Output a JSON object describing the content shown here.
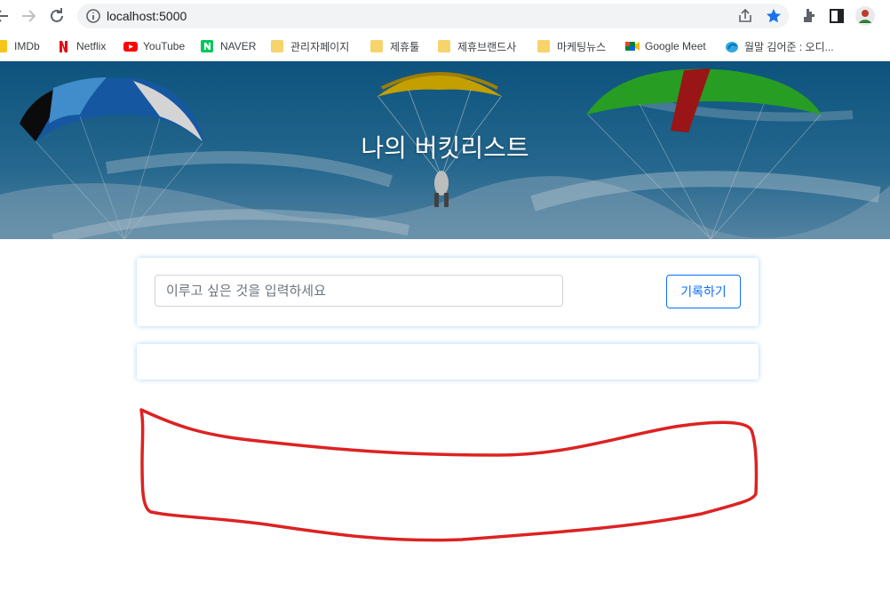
{
  "browser": {
    "url": "localhost:5000",
    "bookmarks": [
      {
        "label": "IMDb",
        "icon": "imdb-icon"
      },
      {
        "label": "Netflix",
        "icon": "netflix-icon"
      },
      {
        "label": "YouTube",
        "icon": "youtube-icon"
      },
      {
        "label": "NAVER",
        "icon": "naver-icon"
      },
      {
        "label": "관리자페이지",
        "icon": "folder-icon"
      },
      {
        "label": "제휴툴",
        "icon": "folder-icon"
      },
      {
        "label": "제휴브랜드사",
        "icon": "folder-icon"
      },
      {
        "label": "마케팅뉴스",
        "icon": "folder-icon"
      },
      {
        "label": "Google Meet",
        "icon": "google-meet-icon"
      },
      {
        "label": "월말 김어준 : 오디...",
        "icon": "podcast-icon"
      }
    ]
  },
  "page": {
    "title": "나의 버킷리스트",
    "input_placeholder": "이루고 싶은 것을 입력하세요",
    "input_value": "",
    "record_button": "기록하기"
  },
  "colors": {
    "accent": "#0d6efd",
    "annotation": "#dd2222",
    "star": "#1a73e8"
  }
}
